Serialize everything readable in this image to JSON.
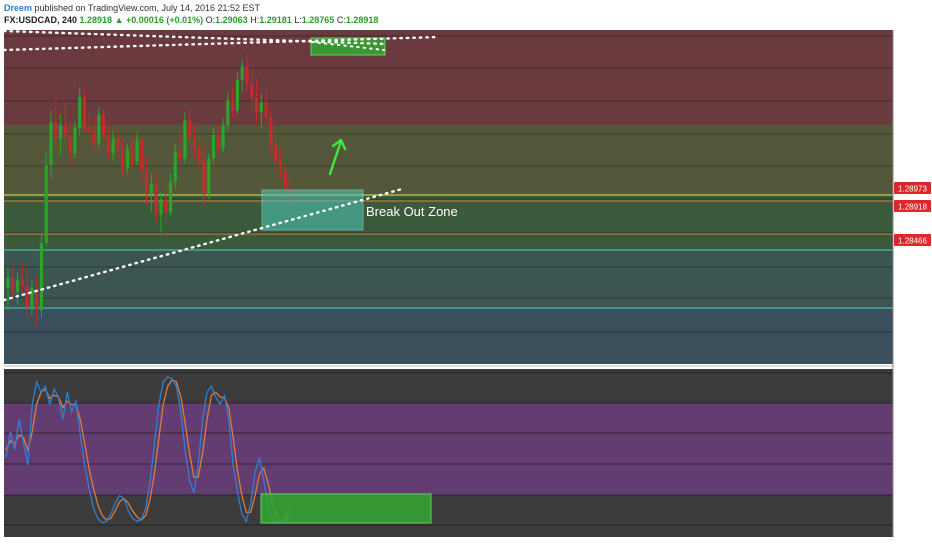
{
  "header": {
    "author": "Dreem",
    "published_text": "published on TradingView.com, July 14, 2016 21:52 EST",
    "symbol": "FX:USDCAD, 240",
    "last": "1.28918",
    "change": "+0.00016 (+0.01%)",
    "ohlc": {
      "o": "1.29063",
      "h": "1.29181",
      "l": "1.28765",
      "c": "1.28918"
    }
  },
  "colors": {
    "zone_red": "#6b3a3f",
    "zone_olive": "#55573a",
    "zone_green": "#3a5a3c",
    "zone_teal": "#3a5552",
    "zone_blue": "#3a4e5c",
    "candle_up": "#2aa52a",
    "candle_down": "#c62a2a",
    "stoch_k": "#2f7fd0",
    "stoch_d": "#e07a3a",
    "stoch_band": "#6a3d7a",
    "highlight_green": "#33a833",
    "highlight_teal": "#4fc8b8",
    "price_tag": "#e0262a"
  },
  "annotations": {
    "break_out_label": "Break Out Zone",
    "arrow_icon": "up-arrow-icon"
  },
  "chart_data": {
    "type": "candlestick",
    "title": "",
    "price_tags": [
      "1.28973",
      "1.28918",
      "1.28466"
    ],
    "price_candles": [
      {
        "o": 1.2798,
        "h": 1.2818,
        "l": 1.2776,
        "c": 1.2808
      },
      {
        "o": 1.2808,
        "h": 1.282,
        "l": 1.2786,
        "c": 1.2794
      },
      {
        "o": 1.2794,
        "h": 1.2813,
        "l": 1.2781,
        "c": 1.2806
      },
      {
        "o": 1.2806,
        "h": 1.2823,
        "l": 1.2794,
        "c": 1.28
      },
      {
        "o": 1.28,
        "h": 1.2817,
        "l": 1.2767,
        "c": 1.2779
      },
      {
        "o": 1.2779,
        "h": 1.2806,
        "l": 1.277,
        "c": 1.2798
      },
      {
        "o": 1.2798,
        "h": 1.281,
        "l": 1.276,
        "c": 1.2776
      },
      {
        "o": 1.2776,
        "h": 1.285,
        "l": 1.2768,
        "c": 1.2842
      },
      {
        "o": 1.2842,
        "h": 1.293,
        "l": 1.2838,
        "c": 1.2918
      },
      {
        "o": 1.2918,
        "h": 1.2972,
        "l": 1.2905,
        "c": 1.296
      },
      {
        "o": 1.296,
        "h": 1.2983,
        "l": 1.293,
        "c": 1.2945
      },
      {
        "o": 1.2945,
        "h": 1.2968,
        "l": 1.2928,
        "c": 1.2958
      },
      {
        "o": 1.2958,
        "h": 1.298,
        "l": 1.294,
        "c": 1.2948
      },
      {
        "o": 1.2948,
        "h": 1.2962,
        "l": 1.2918,
        "c": 1.293
      },
      {
        "o": 1.293,
        "h": 1.296,
        "l": 1.2925,
        "c": 1.2955
      },
      {
        "o": 1.2955,
        "h": 1.2995,
        "l": 1.2948,
        "c": 1.2985
      },
      {
        "o": 1.2985,
        "h": 1.2992,
        "l": 1.295,
        "c": 1.2956
      },
      {
        "o": 1.2956,
        "h": 1.297,
        "l": 1.294,
        "c": 1.2952
      },
      {
        "o": 1.2952,
        "h": 1.2966,
        "l": 1.2932,
        "c": 1.294
      },
      {
        "o": 1.294,
        "h": 1.2975,
        "l": 1.2935,
        "c": 1.2968
      },
      {
        "o": 1.2968,
        "h": 1.2972,
        "l": 1.2938,
        "c": 1.2946
      },
      {
        "o": 1.2946,
        "h": 1.2958,
        "l": 1.2925,
        "c": 1.293
      },
      {
        "o": 1.293,
        "h": 1.2952,
        "l": 1.2922,
        "c": 1.2944
      },
      {
        "o": 1.2944,
        "h": 1.2955,
        "l": 1.2926,
        "c": 1.2932
      },
      {
        "o": 1.2932,
        "h": 1.2946,
        "l": 1.2908,
        "c": 1.2915
      },
      {
        "o": 1.2915,
        "h": 1.294,
        "l": 1.291,
        "c": 1.2934
      },
      {
        "o": 1.2934,
        "h": 1.2945,
        "l": 1.2915,
        "c": 1.2922
      },
      {
        "o": 1.2922,
        "h": 1.295,
        "l": 1.2918,
        "c": 1.2943
      },
      {
        "o": 1.2943,
        "h": 1.2947,
        "l": 1.2905,
        "c": 1.2912
      },
      {
        "o": 1.2912,
        "h": 1.2928,
        "l": 1.288,
        "c": 1.289
      },
      {
        "o": 1.289,
        "h": 1.291,
        "l": 1.2872,
        "c": 1.29
      },
      {
        "o": 1.29,
        "h": 1.2912,
        "l": 1.286,
        "c": 1.287
      },
      {
        "o": 1.287,
        "h": 1.2892,
        "l": 1.2852,
        "c": 1.2885
      },
      {
        "o": 1.2885,
        "h": 1.2898,
        "l": 1.2862,
        "c": 1.2872
      },
      {
        "o": 1.2872,
        "h": 1.291,
        "l": 1.2868,
        "c": 1.2902
      },
      {
        "o": 1.2902,
        "h": 1.294,
        "l": 1.2895,
        "c": 1.2932
      },
      {
        "o": 1.2932,
        "h": 1.295,
        "l": 1.2918,
        "c": 1.2925
      },
      {
        "o": 1.2925,
        "h": 1.297,
        "l": 1.292,
        "c": 1.2962
      },
      {
        "o": 1.2962,
        "h": 1.2975,
        "l": 1.2938,
        "c": 1.2945
      },
      {
        "o": 1.2945,
        "h": 1.296,
        "l": 1.2925,
        "c": 1.2935
      },
      {
        "o": 1.2935,
        "h": 1.2948,
        "l": 1.2915,
        "c": 1.2922
      },
      {
        "o": 1.2922,
        "h": 1.2938,
        "l": 1.288,
        "c": 1.289
      },
      {
        "o": 1.289,
        "h": 1.293,
        "l": 1.2885,
        "c": 1.2925
      },
      {
        "o": 1.2925,
        "h": 1.2955,
        "l": 1.2918,
        "c": 1.2948
      },
      {
        "o": 1.2948,
        "h": 1.2958,
        "l": 1.2928,
        "c": 1.2935
      },
      {
        "o": 1.2935,
        "h": 1.2965,
        "l": 1.293,
        "c": 1.2958
      },
      {
        "o": 1.2958,
        "h": 1.299,
        "l": 1.2952,
        "c": 1.2982
      },
      {
        "o": 1.2982,
        "h": 1.2995,
        "l": 1.2965,
        "c": 1.2972
      },
      {
        "o": 1.2972,
        "h": 1.301,
        "l": 1.2968,
        "c": 1.3002
      },
      {
        "o": 1.3002,
        "h": 1.3022,
        "l": 1.299,
        "c": 1.3015
      },
      {
        "o": 1.3015,
        "h": 1.3027,
        "l": 1.299,
        "c": 1.2998
      },
      {
        "o": 1.2998,
        "h": 1.3012,
        "l": 1.2975,
        "c": 1.2984
      },
      {
        "o": 1.2984,
        "h": 1.3003,
        "l": 1.296,
        "c": 1.297
      },
      {
        "o": 1.297,
        "h": 1.2988,
        "l": 1.2955,
        "c": 1.298
      },
      {
        "o": 1.298,
        "h": 1.2992,
        "l": 1.2958,
        "c": 1.2965
      },
      {
        "o": 1.2965,
        "h": 1.2975,
        "l": 1.293,
        "c": 1.2938
      },
      {
        "o": 1.2938,
        "h": 1.2952,
        "l": 1.2915,
        "c": 1.2922
      },
      {
        "o": 1.2922,
        "h": 1.2935,
        "l": 1.2905,
        "c": 1.2912
      },
      {
        "o": 1.2912,
        "h": 1.292,
        "l": 1.2885,
        "c": 1.2895
      },
      {
        "o": 1.2895,
        "h": 1.2906,
        "l": 1.2877,
        "c": 1.2892
      }
    ],
    "stochastic_k": [
      45,
      62,
      50,
      70,
      55,
      40,
      80,
      95,
      88,
      92,
      80,
      90,
      85,
      70,
      88,
      75,
      82,
      60,
      40,
      25,
      12,
      5,
      2,
      3,
      8,
      15,
      20,
      18,
      10,
      5,
      3,
      4,
      12,
      30,
      55,
      80,
      95,
      98,
      97,
      92,
      75,
      50,
      30,
      22,
      40,
      70,
      88,
      92,
      85,
      80,
      86,
      70,
      40,
      22,
      8,
      3,
      15,
      35,
      45,
      30,
      12,
      4,
      2,
      3,
      6,
      14
    ],
    "stochastic_d": [
      50,
      56,
      54,
      60,
      58,
      50,
      62,
      80,
      88,
      90,
      84,
      86,
      85,
      78,
      82,
      80,
      80,
      70,
      55,
      38,
      25,
      14,
      7,
      4,
      5,
      10,
      16,
      18,
      15,
      10,
      6,
      4,
      7,
      18,
      35,
      58,
      80,
      92,
      96,
      95,
      85,
      68,
      48,
      32,
      32,
      48,
      70,
      86,
      88,
      85,
      84,
      78,
      58,
      36,
      20,
      9,
      9,
      20,
      34,
      38,
      28,
      15,
      6,
      3,
      4,
      8
    ]
  }
}
